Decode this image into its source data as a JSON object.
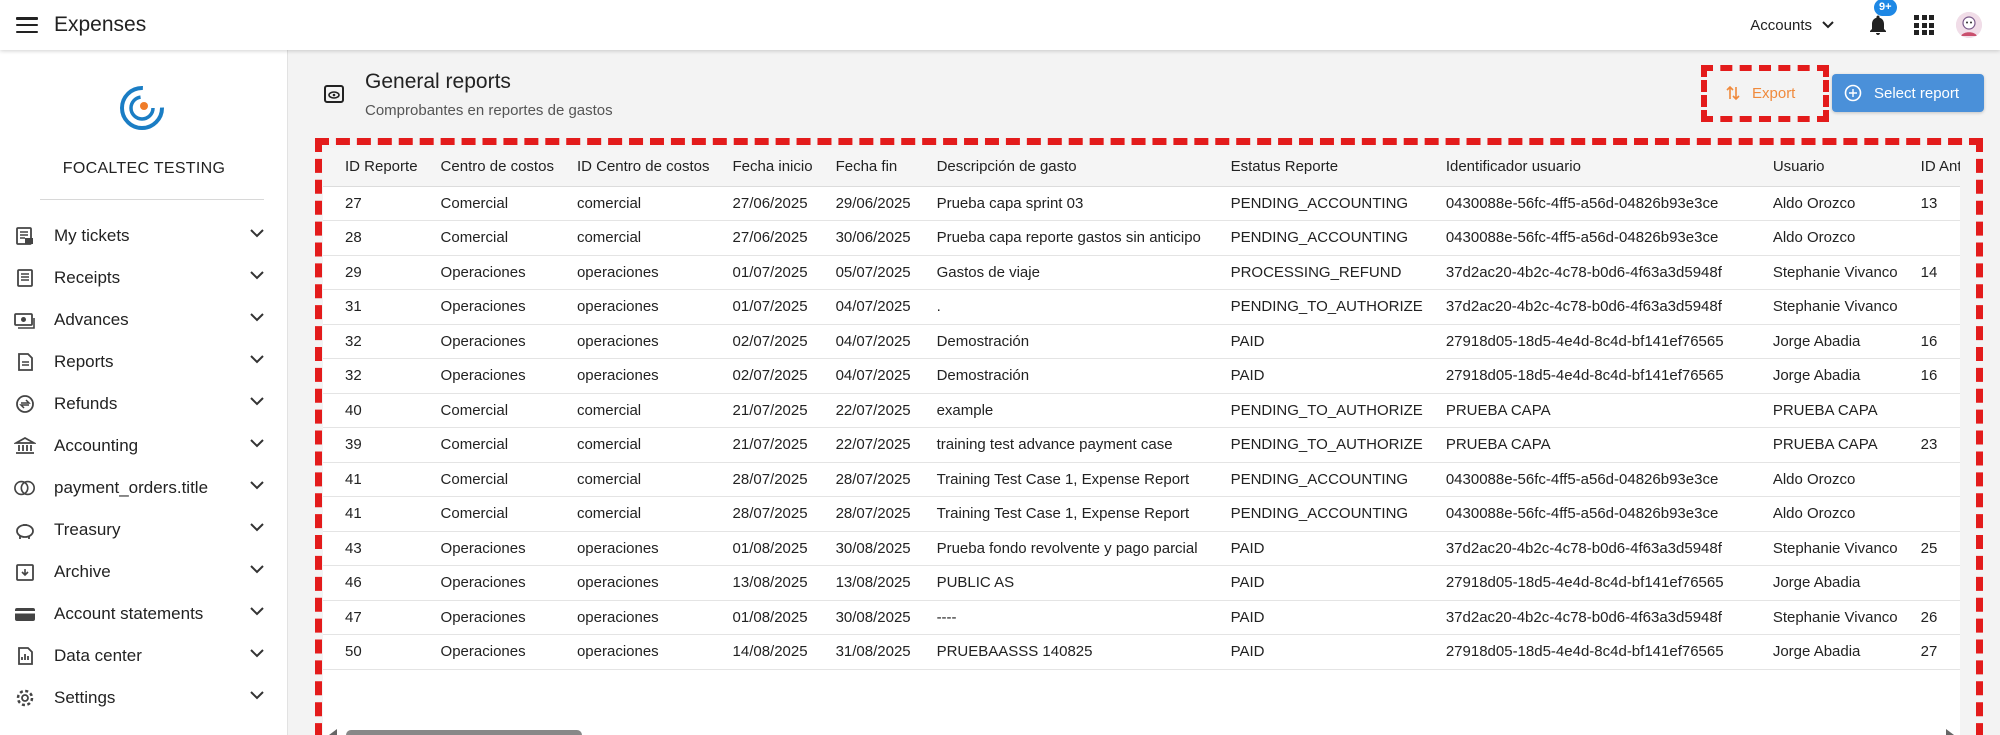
{
  "app": {
    "title": "Expenses"
  },
  "header": {
    "accounts_label": "Accounts",
    "notification_badge": "9+"
  },
  "sidebar": {
    "org_name": "FOCALTEC TESTING",
    "items": [
      {
        "label": "My tickets",
        "icon": "ticket-icon"
      },
      {
        "label": "Receipts",
        "icon": "receipt-icon"
      },
      {
        "label": "Advances",
        "icon": "cash-icon"
      },
      {
        "label": "Reports",
        "icon": "report-icon"
      },
      {
        "label": "Refunds",
        "icon": "refund-icon"
      },
      {
        "label": "Accounting",
        "icon": "bank-icon"
      },
      {
        "label": "payment_orders.title",
        "icon": "payment-icon"
      },
      {
        "label": "Treasury",
        "icon": "piggy-bank-icon"
      },
      {
        "label": "Archive",
        "icon": "archive-icon"
      },
      {
        "label": "Account statements",
        "icon": "wallet-icon"
      },
      {
        "label": "Data center",
        "icon": "data-icon"
      },
      {
        "label": "Settings",
        "icon": "gear-icon"
      }
    ]
  },
  "page": {
    "title": "General reports",
    "subtitle": "Comprobantes en reportes de gastos",
    "export_label": "Export",
    "select_report_label": "Select report"
  },
  "table": {
    "columns": [
      "ID Reporte",
      "Centro de costos",
      "ID Centro de costos",
      "Fecha inicio",
      "Fecha fin",
      "Descripción de gasto",
      "Estatus Reporte",
      "Identificador usuario",
      "Usuario",
      "ID Anticip"
    ],
    "rows": [
      [
        "27",
        "Comercial",
        "comercial",
        "27/06/2025",
        "29/06/2025",
        "Prueba capa sprint 03",
        "PENDING_ACCOUNTING",
        "0430088e-56fc-4ff5-a56d-04826b93e3ce",
        "Aldo Orozco",
        "13"
      ],
      [
        "28",
        "Comercial",
        "comercial",
        "27/06/2025",
        "30/06/2025",
        "Prueba capa reporte gastos sin anticipo",
        "PENDING_ACCOUNTING",
        "0430088e-56fc-4ff5-a56d-04826b93e3ce",
        "Aldo Orozco",
        ""
      ],
      [
        "29",
        "Operaciones",
        "operaciones",
        "01/07/2025",
        "05/07/2025",
        "Gastos de viaje",
        "PROCESSING_REFUND",
        "37d2ac20-4b2c-4c78-b0d6-4f63a3d5948f",
        "Stephanie Vivanco",
        "14"
      ],
      [
        "31",
        "Operaciones",
        "operaciones",
        "01/07/2025",
        "04/07/2025",
        ".",
        "PENDING_TO_AUTHORIZE",
        "37d2ac20-4b2c-4c78-b0d6-4f63a3d5948f",
        "Stephanie Vivanco",
        ""
      ],
      [
        "32",
        "Operaciones",
        "operaciones",
        "02/07/2025",
        "04/07/2025",
        "Demostración",
        "PAID",
        "27918d05-18d5-4e4d-8c4d-bf141ef76565",
        "Jorge Abadia",
        "16"
      ],
      [
        "32",
        "Operaciones",
        "operaciones",
        "02/07/2025",
        "04/07/2025",
        "Demostración",
        "PAID",
        "27918d05-18d5-4e4d-8c4d-bf141ef76565",
        "Jorge Abadia",
        "16"
      ],
      [
        "40",
        "Comercial",
        "comercial",
        "21/07/2025",
        "22/07/2025",
        "example",
        "PENDING_TO_AUTHORIZE",
        "PRUEBA CAPA",
        "PRUEBA CAPA",
        ""
      ],
      [
        "39",
        "Comercial",
        "comercial",
        "21/07/2025",
        "22/07/2025",
        "training test advance payment case",
        "PENDING_TO_AUTHORIZE",
        "PRUEBA CAPA",
        "PRUEBA CAPA",
        "23"
      ],
      [
        "41",
        "Comercial",
        "comercial",
        "28/07/2025",
        "28/07/2025",
        "Training Test Case 1, Expense Report",
        "PENDING_ACCOUNTING",
        "0430088e-56fc-4ff5-a56d-04826b93e3ce",
        "Aldo Orozco",
        ""
      ],
      [
        "41",
        "Comercial",
        "comercial",
        "28/07/2025",
        "28/07/2025",
        "Training Test Case 1, Expense Report",
        "PENDING_ACCOUNTING",
        "0430088e-56fc-4ff5-a56d-04826b93e3ce",
        "Aldo Orozco",
        ""
      ],
      [
        "43",
        "Operaciones",
        "operaciones",
        "01/08/2025",
        "30/08/2025",
        "Prueba fondo revolvente y pago parcial",
        "PAID",
        "37d2ac20-4b2c-4c78-b0d6-4f63a3d5948f",
        "Stephanie Vivanco",
        "25"
      ],
      [
        "46",
        "Operaciones",
        "operaciones",
        "13/08/2025",
        "13/08/2025",
        "PUBLIC AS",
        "PAID",
        "27918d05-18d5-4e4d-8c4d-bf141ef76565",
        "Jorge Abadia",
        ""
      ],
      [
        "47",
        "Operaciones",
        "operaciones",
        "01/08/2025",
        "30/08/2025",
        "----",
        "PAID",
        "37d2ac20-4b2c-4c78-b0d6-4f63a3d5948f",
        "Stephanie Vivanco",
        "26"
      ],
      [
        "50",
        "Operaciones",
        "operaciones",
        "14/08/2025",
        "31/08/2025",
        "PRUEBAASSS 140825",
        "PAID",
        "27918d05-18d5-4e4d-8c4d-bf141ef76565",
        "Jorge Abadia",
        "27"
      ]
    ]
  },
  "colors": {
    "accent": "#4a90d9",
    "export": "#f08a3c",
    "highlight": "#e31b1b",
    "badge": "#1e88e5"
  }
}
